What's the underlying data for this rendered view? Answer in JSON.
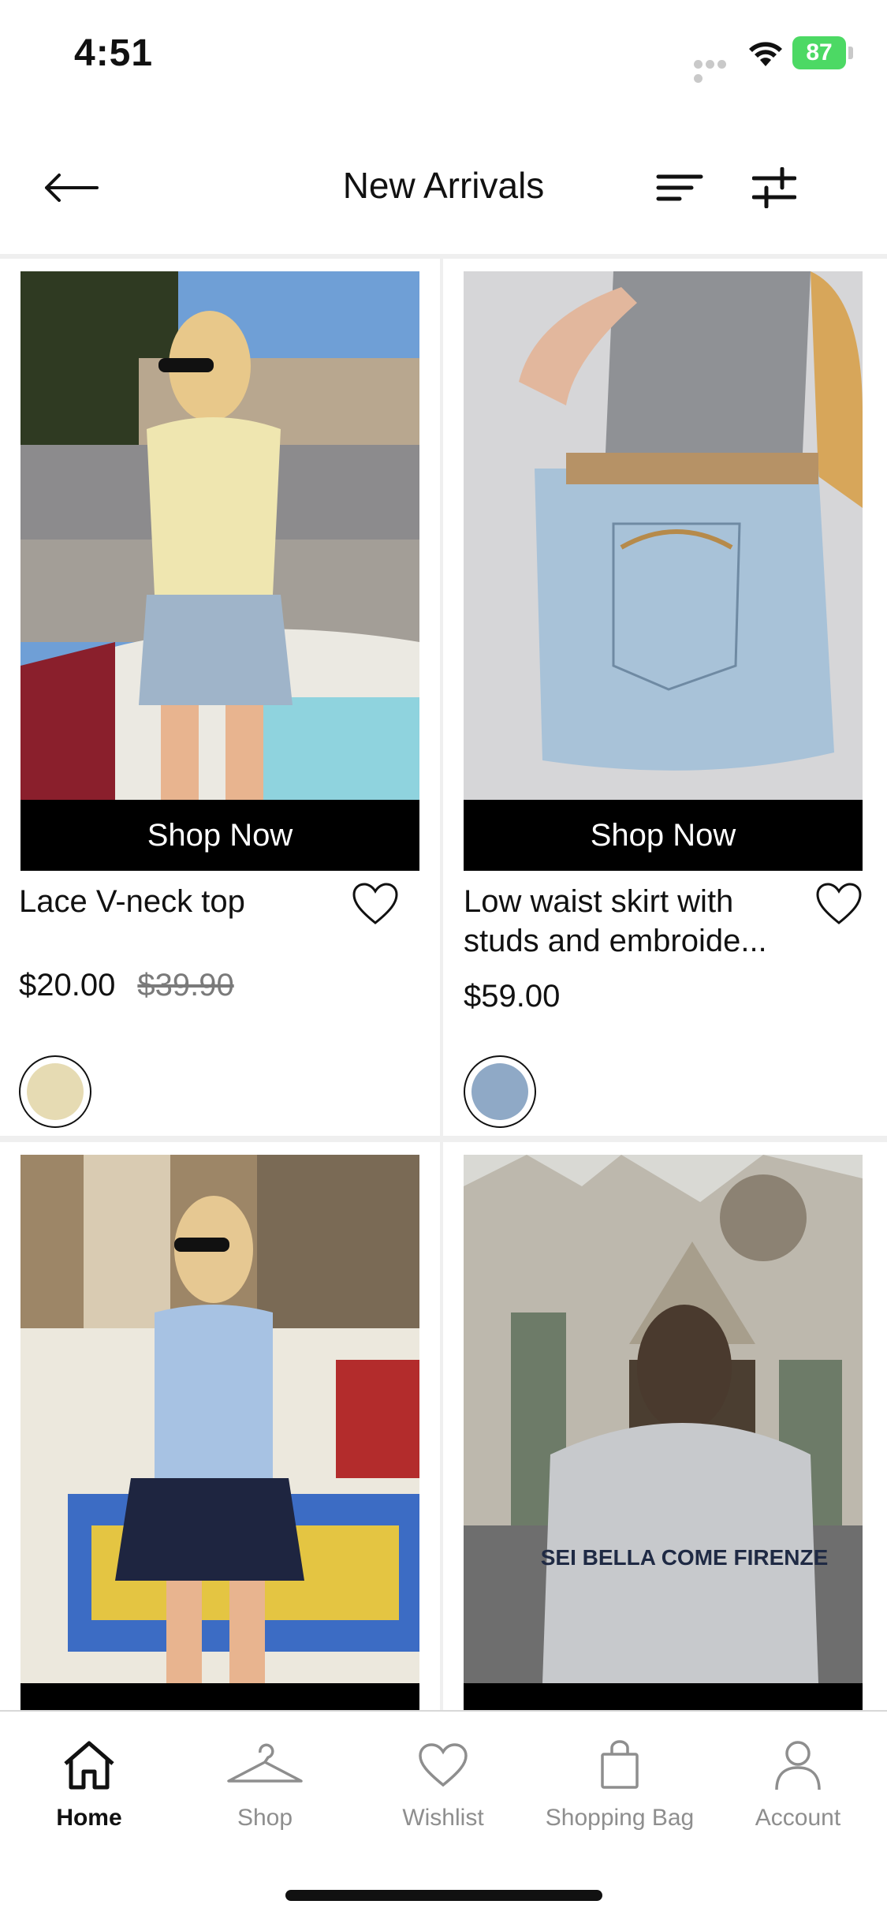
{
  "status_bar": {
    "time": "4:51",
    "battery": "87"
  },
  "header": {
    "title": "New Arrivals",
    "back_icon": "arrow-left-icon",
    "sort_icon": "sort-icon",
    "filter_icon": "sliders-icon"
  },
  "products": [
    {
      "name": "Lace V-neck top",
      "price": "$20.00",
      "original_price": "$39.90",
      "cta": "Shop Now",
      "swatch_color": "#e6dbb3"
    },
    {
      "name": "Low waist skirt with studs and embroide...",
      "price": "$59.00",
      "cta": "Shop Now",
      "swatch_color": "#8fa9c6"
    },
    {
      "image_text": "SEI BELLA COME FIRENZE"
    }
  ],
  "tabbar": {
    "items": [
      {
        "label": "Home",
        "icon": "home-icon",
        "active": true
      },
      {
        "label": "Shop",
        "icon": "hanger-icon",
        "active": false
      },
      {
        "label": "Wishlist",
        "icon": "heart-icon",
        "active": false
      },
      {
        "label": "Shopping Bag",
        "icon": "bag-icon",
        "active": false
      },
      {
        "label": "Account",
        "icon": "person-icon",
        "active": false
      }
    ]
  },
  "colors": {
    "accent": "#000000",
    "inactive": "#8e8e8e",
    "battery": "#4cd964",
    "grid_bg": "#efefef"
  }
}
